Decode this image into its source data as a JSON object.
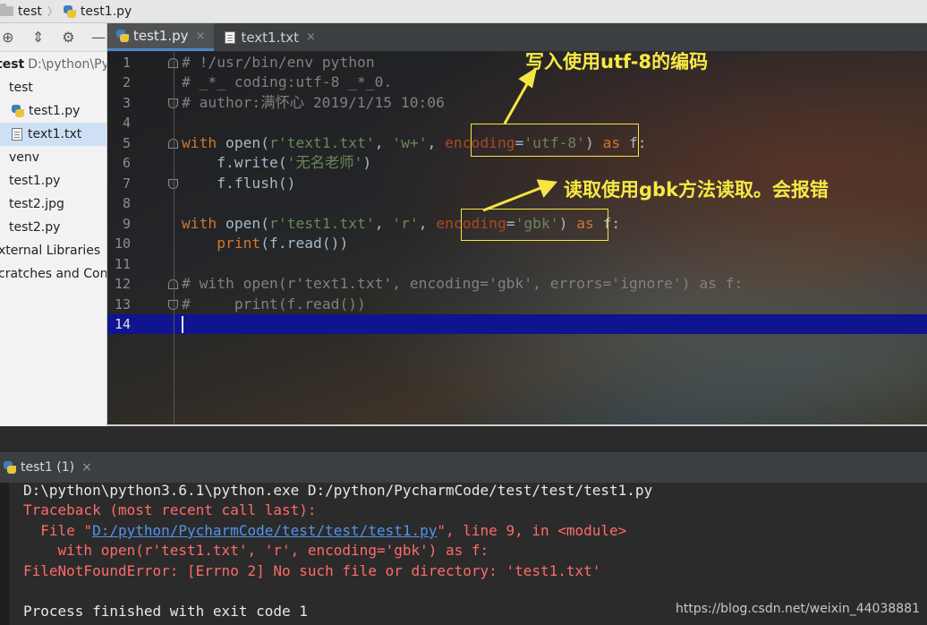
{
  "breadcrumb": {
    "items": [
      "test",
      "test1.py"
    ]
  },
  "sidebar": {
    "toolbar_icons": [
      "target-icon",
      "collapse-icon",
      "gear-icon",
      "minimize-icon"
    ],
    "items": [
      {
        "label": "test",
        "extra": "D:\\python\\Py",
        "icon": "folder-icon"
      },
      {
        "label": "test",
        "icon": "folder-icon"
      },
      {
        "label": "test1.py",
        "icon": "python-file-icon"
      },
      {
        "label": "text1.txt",
        "icon": "text-file-icon"
      },
      {
        "label": "venv",
        "icon": "folder-icon"
      },
      {
        "label": "test1.py",
        "icon": "python-file-icon"
      },
      {
        "label": "test2.jpg",
        "icon": "image-file-icon"
      },
      {
        "label": "test2.py",
        "icon": "python-file-icon"
      },
      {
        "label": "xternal Libraries",
        "icon": "library-icon"
      },
      {
        "label": "cratches and Con",
        "icon": "scratch-icon"
      }
    ]
  },
  "tabs": [
    {
      "label": "test1.py",
      "close": "×",
      "active": true
    },
    {
      "label": "text1.txt",
      "close": "×",
      "active": false
    }
  ],
  "editor": {
    "line_numbers": [
      "1",
      "2",
      "3",
      "4",
      "5",
      "6",
      "7",
      "8",
      "9",
      "10",
      "11",
      "12",
      "13",
      "14"
    ],
    "annotations": {
      "top": "写入使用utf-8的编码",
      "middle": "读取使用gbk方法读取。会报错"
    }
  },
  "run": {
    "tab_label": "test1 (1)",
    "close": "×",
    "console": {
      "line1": "D:\\python\\python3.6.1\\python.exe D:/python/PycharmCode/test/test/test1.py",
      "line2": "Traceback (most recent call last):",
      "line3_pre": "  File \"",
      "line3_link": "D:/python/PycharmCode/test/test/test1.py",
      "line3_post": "\", line 9, in <module>",
      "line4": "    with open(r'test1.txt', 'r', encoding='gbk') as f:",
      "line5": "FileNotFoundError: [Errno 2] No such file or directory: 'test1.txt'",
      "line7": "Process finished with exit code 1"
    },
    "watermark": "https://blog.csdn.net/weixin_44038881"
  }
}
